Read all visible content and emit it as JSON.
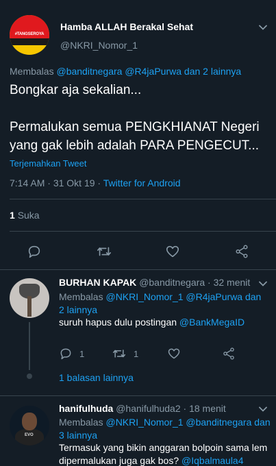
{
  "main_tweet": {
    "author_name": "Hamba ALLAH Berakal Sehat",
    "author_handle": "@NKRI_Nomor_1",
    "avatar_text": "#TANGSEROYA",
    "reply_prefix": "Membalas",
    "reply_to_1": "@banditnegara",
    "reply_to_2": "@R4jaPurwa",
    "reply_to_more": "dan 2 lainnya",
    "text_line_1": "Bongkar aja sekalian...",
    "text_line_2": "Permalukan semua PENGKHIANAT Negeri yang gak lebih adalah PARA PENGECUT...",
    "translate_label": "Terjemahkan Tweet",
    "time": "7:14 AM",
    "date": "31 Okt 19",
    "source": "Twitter for Android",
    "like_count": "1",
    "like_label": "Suka"
  },
  "replies": [
    {
      "name": "BURHAN KAPAK",
      "handle": "@banditnegara",
      "time": "32 menit",
      "reply_prefix": "Membalas",
      "reply_to": "@NKRI_Nomor_1 @R4jaPurwa",
      "reply_to_more": "dan 2 lainnya",
      "text_prefix": "suruh hapus dulu postingan ",
      "text_mention": "@BankMegaID",
      "reply_count": "1",
      "retweet_count": "1",
      "more_replies": "1 balasan lainnya"
    },
    {
      "name": "hanifulhuda",
      "handle": "@hanifulhuda2",
      "time": "18 menit",
      "reply_prefix": "Membalas",
      "reply_to": "@NKRI_Nomor_1 @banditnegara",
      "reply_to_more": "dan 3 lainnya",
      "avatar_text": "EVO",
      "text_line_1": "Termasuk yang bikin anggaran bolpoin sama lem",
      "text_line_2_prefix": "dipermalukan juga gak bos? ",
      "text_mention": "@Iqbalmaula4"
    }
  ],
  "colors": {
    "background": "#141d26",
    "link": "#1da1f2",
    "muted": "#8899a6",
    "separator": "#38444d"
  },
  "icons": [
    "chevron-down-icon",
    "reply-icon",
    "retweet-icon",
    "like-icon",
    "share-icon"
  ]
}
